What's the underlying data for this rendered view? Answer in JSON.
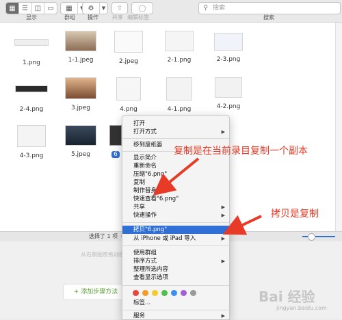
{
  "toolbar": {
    "display_label": "显示",
    "group_label": "群组",
    "action_label": "操作",
    "share_label": "共享",
    "edit_tags_label": "编辑标签",
    "search_label": "搜索",
    "search_placeholder": "搜索"
  },
  "files": [
    {
      "name": "1.png"
    },
    {
      "name": "1-1.jpeg"
    },
    {
      "name": "2.jpeg"
    },
    {
      "name": "2-1.png"
    },
    {
      "name": "2-3.png"
    },
    {
      "name": "2-4.png"
    },
    {
      "name": "3.jpeg"
    },
    {
      "name": "4.png"
    },
    {
      "name": "4-1.png"
    },
    {
      "name": "4-2.png"
    },
    {
      "name": "4-3.png"
    },
    {
      "name": "5.jpeg"
    },
    {
      "name": "6"
    }
  ],
  "status": {
    "text": "选择了 1 项（共"
  },
  "below": {
    "hint": "从右侧图库拖动图",
    "add_step": "+ 添加步骤方法"
  },
  "context_menu": {
    "open": "打开",
    "open_with": "打开方式",
    "move_to_trash": "移到废纸篓",
    "get_info": "显示简介",
    "rename": "重新命名",
    "compress": "压缩\"6.png\"",
    "duplicate": "复制",
    "make_alias": "制作替身",
    "quick_look": "快速查看\"6.png\"",
    "share": "共享",
    "quick_actions": "快速操作",
    "copy": "拷贝\"6.png\"",
    "import_from_iphone": "从 iPhone 或 iPad 导入",
    "use_groups": "使用群组",
    "sort_by": "排序方式",
    "clean_up_selection": "整理所选内容",
    "show_view_options": "查看显示选项",
    "tags": "标签...",
    "services": "服务",
    "tag_colors": [
      "#e8453c",
      "#f39c2b",
      "#f2cc2e",
      "#4cc04b",
      "#3c8ef0",
      "#a25fd6",
      "#9a9a9a"
    ]
  },
  "annotations": {
    "duplicate_note": "复制是在当前录目复制一个副本",
    "copy_note": "拷贝是复制"
  },
  "watermark": {
    "brand": "Bai 经验",
    "url": "jingyan.baidu.com"
  }
}
